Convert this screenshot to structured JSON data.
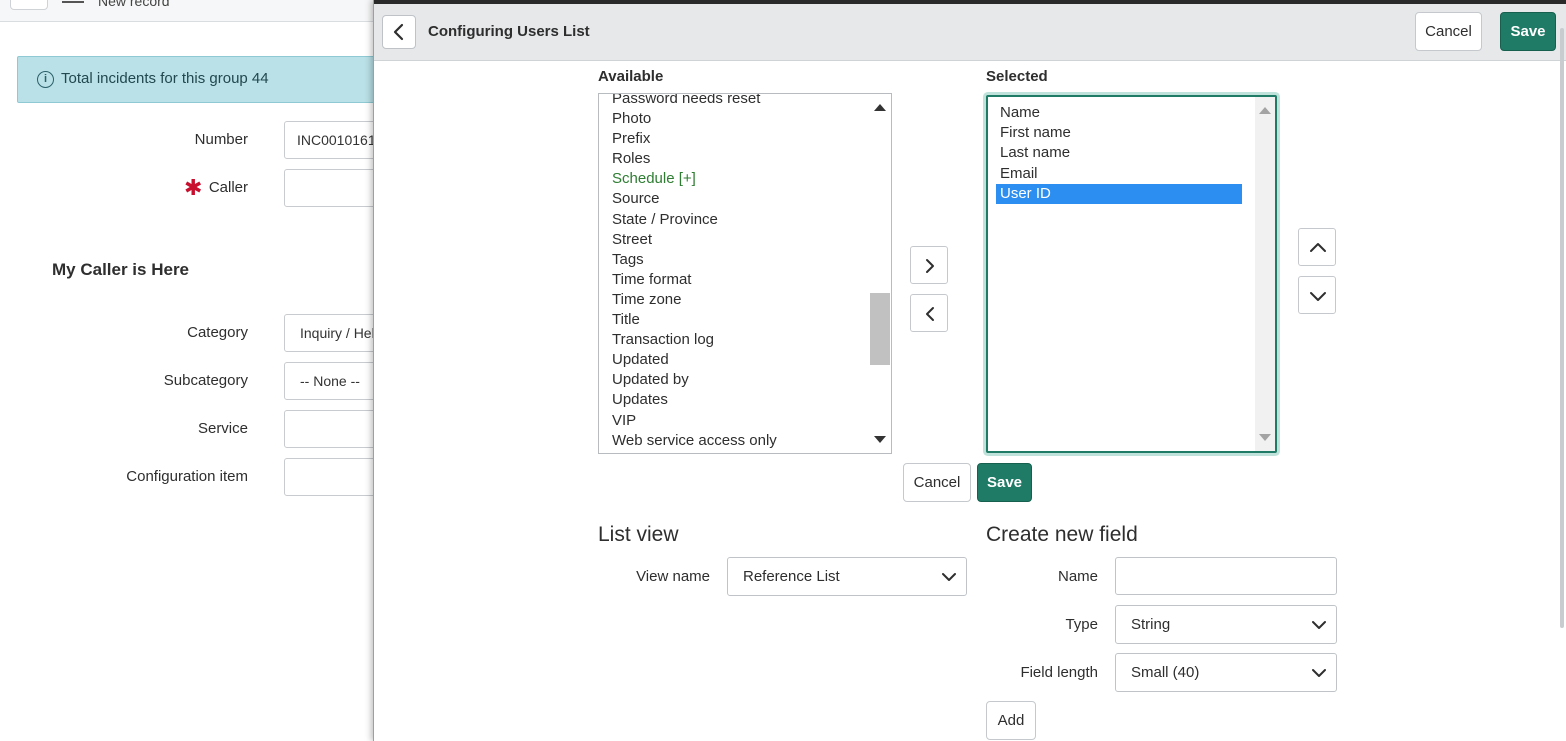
{
  "background": {
    "header_title": "New record",
    "alert_text": "Total incidents for this group 44",
    "fields": {
      "number_label": "Number",
      "number_value": "INC0010161",
      "caller_label": "Caller",
      "section_title": "My Caller is Here",
      "category_label": "Category",
      "category_value": "Inquiry / Help",
      "subcategory_label": "Subcategory",
      "subcategory_value": "-- None --",
      "service_label": "Service",
      "ci_label": "Configuration item"
    }
  },
  "modal": {
    "title": "Configuring Users List",
    "cancel_label": "Cancel",
    "save_label": "Save",
    "available_label": "Available",
    "selected_label": "Selected",
    "available_items": [
      "Password needs reset",
      "Photo",
      "Prefix",
      "Roles",
      "Schedule [+]",
      "Source",
      "State / Province",
      "Street",
      "Tags",
      "Time format",
      "Time zone",
      "Title",
      "Transaction log",
      "Updated",
      "Updated by",
      "Updates",
      "VIP",
      "Web service access only"
    ],
    "selected_items": [
      "Name",
      "First name",
      "Last name",
      "Email",
      "User ID"
    ],
    "inner_cancel_label": "Cancel",
    "inner_save_label": "Save",
    "list_view": {
      "heading": "List view",
      "view_name_label": "View name",
      "view_name_value": "Reference List"
    },
    "create_field": {
      "heading": "Create new field",
      "name_label": "Name",
      "name_value": "",
      "type_label": "Type",
      "type_value": "String",
      "length_label": "Field length",
      "length_value": "Small (40)",
      "add_label": "Add"
    }
  },
  "colors": {
    "primary": "#1f7a66",
    "selection": "#2d8ef1",
    "alert_bg": "#b9e1e7",
    "required": "#c8102e",
    "link_green": "#2e7d32"
  }
}
